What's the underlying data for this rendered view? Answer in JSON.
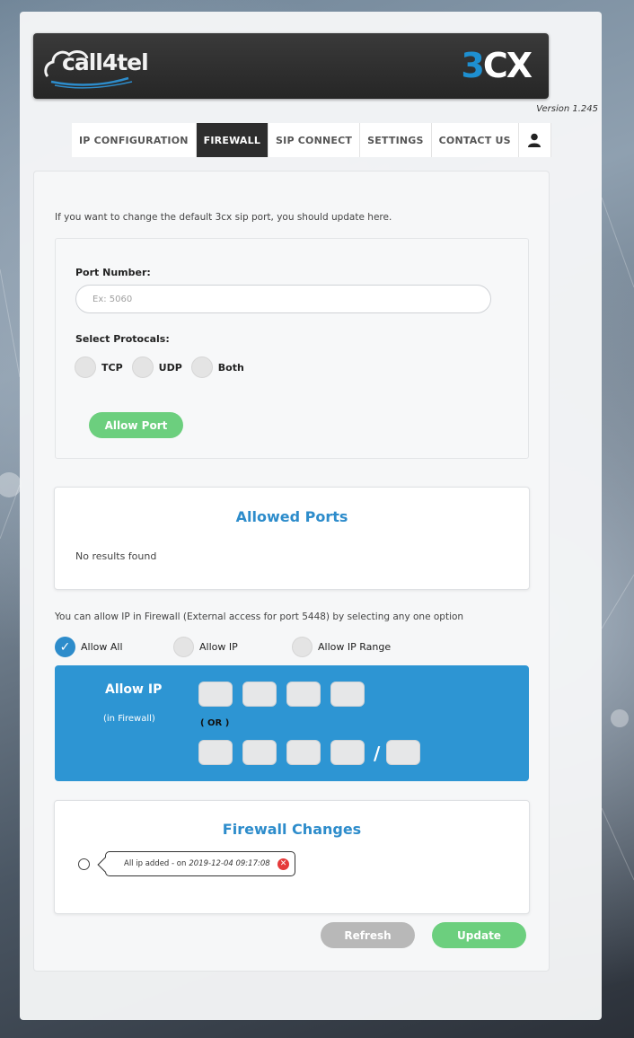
{
  "header": {
    "brand_left": "call4tel",
    "brand_right_num": "3",
    "brand_right_text": "CX",
    "version": "Version 1.245"
  },
  "nav": {
    "tabs": [
      {
        "label": "IP CONFIGURATION",
        "active": false
      },
      {
        "label": "FIREWALL",
        "active": true
      },
      {
        "label": "SIP CONNECT",
        "active": false
      },
      {
        "label": "SETTINGS",
        "active": false
      },
      {
        "label": "CONTACT US",
        "active": false
      }
    ],
    "user_icon": "user-icon"
  },
  "port_section": {
    "intro": "If you want to change the default 3cx sip port, you should update here.",
    "port_label": "Port Number:",
    "port_placeholder": "Ex: 5060",
    "port_value": "",
    "protocol_label": "Select Protocals:",
    "protocols": [
      "TCP",
      "UDP",
      "Both"
    ],
    "allow_button": "Allow Port"
  },
  "allowed_ports": {
    "title": "Allowed Ports",
    "empty_text": "No results found"
  },
  "ip_section": {
    "note": "You can allow IP in Firewall (External access for port 5448) by selecting any one option",
    "options": [
      {
        "label": "Allow All",
        "checked": true
      },
      {
        "label": "Allow IP",
        "checked": false
      },
      {
        "label": "Allow IP Range",
        "checked": false
      }
    ],
    "allow_ip_title": "Allow IP",
    "allow_ip_sub": "(in Firewall)",
    "or_label": "( OR )",
    "slash": "/"
  },
  "firewall_changes": {
    "title": "Firewall Changes",
    "items": [
      {
        "text": "All ip added - on",
        "timestamp": "2019-12-04 09:17:08"
      }
    ]
  },
  "footer": {
    "refresh_button": "Refresh",
    "update_button": "Update"
  },
  "colors": {
    "accent_blue": "#2d8ccb",
    "blue_panel": "#2d95d3",
    "green_button": "#6ccf7e",
    "gray_button": "#b8b8b8",
    "header_dark": "#2d2d2d",
    "delete_red": "#e53a3a"
  }
}
